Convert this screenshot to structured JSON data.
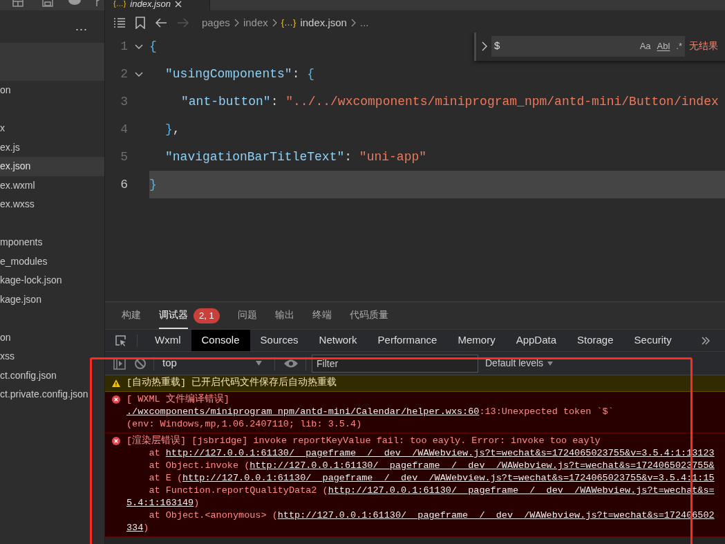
{
  "editor_tab": {
    "icon": "{…}",
    "label": "index.json"
  },
  "sidebar": {
    "more": "...",
    "items": [
      {
        "label": "on",
        "selected": false
      },
      {
        "label": "x",
        "selected": false
      },
      {
        "label": "ex.js",
        "selected": false
      },
      {
        "label": "ex.json",
        "selected": true
      },
      {
        "label": "ex.wxml",
        "selected": false
      },
      {
        "label": "ex.wxss",
        "selected": false
      },
      {
        "label": "mponents",
        "selected": false
      },
      {
        "label": "e_modules",
        "selected": false
      },
      {
        "label": "kage-lock.json",
        "selected": false
      },
      {
        "label": "kage.json",
        "selected": false
      },
      {
        "label": "on",
        "selected": false
      },
      {
        "label": "xss",
        "selected": false
      },
      {
        "label": "ct.config.json",
        "selected": false
      },
      {
        "label": "ct.private.config.json",
        "selected": false
      }
    ]
  },
  "breadcrumb": [
    {
      "label": "pages"
    },
    {
      "label": "index"
    },
    {
      "label": "index.json",
      "icon": "{…}"
    },
    {
      "label": "..."
    }
  ],
  "code_lines": [
    {
      "number": "1",
      "fold": true,
      "active": false,
      "tokens": [
        {
          "kind": "brace",
          "s": "{"
        }
      ],
      "children": [
        {
          "number": "2",
          "fold": true,
          "active": false,
          "tokens": [
            {
              "kind": "key",
              "s": "\"usingComponents\""
            },
            {
              "kind": "plain",
              "s": ": "
            },
            {
              "kind": "brace",
              "s": "{"
            }
          ],
          "children": [
            {
              "number": "3",
              "fold": false,
              "active": false,
              "tokens": [
                {
                  "kind": "key",
                  "s": "\"ant-button\""
                },
                {
                  "kind": "plain",
                  "s": ": "
                },
                {
                  "kind": "string",
                  "s": "\"../../wxcomponents/miniprogram_npm/antd-mini/Button/index"
                }
              ]
            }
          ]
        },
        {
          "number": "4",
          "fold": false,
          "active": false,
          "tokens": [
            {
              "kind": "brace",
              "s": "}"
            },
            {
              "kind": "plain",
              "s": ","
            }
          ]
        },
        {
          "number": "5",
          "fold": false,
          "active": false,
          "tokens": [
            {
              "kind": "key",
              "s": "\"navigationBarTitleText\""
            },
            {
              "kind": "plain",
              "s": ": "
            },
            {
              "kind": "string",
              "s": "\"uni-app\""
            }
          ]
        }
      ]
    },
    {
      "number": "6",
      "fold": false,
      "active": true,
      "tokens": [
        {
          "kind": "brace",
          "s": "}"
        }
      ]
    }
  ],
  "find_widget": {
    "value": "$",
    "toggles": [
      "Aa",
      "Abl",
      ".*"
    ],
    "result": "无结果"
  },
  "panel_tabs": [
    {
      "label": "构建",
      "selected": false
    },
    {
      "label": "调试器",
      "selected": true,
      "badge": "2, 1"
    },
    {
      "label": "问题",
      "selected": false
    },
    {
      "label": "输出",
      "selected": false
    },
    {
      "label": "终端",
      "selected": false
    },
    {
      "label": "代码质量",
      "selected": false
    }
  ],
  "devtools_tabs": [
    {
      "label": "Wxml",
      "selected": false
    },
    {
      "label": "Console",
      "selected": true
    },
    {
      "label": "Sources",
      "selected": false
    },
    {
      "label": "Network",
      "selected": false
    },
    {
      "label": "Performance",
      "selected": false
    },
    {
      "label": "Memory",
      "selected": false
    },
    {
      "label": "AppData",
      "selected": false
    },
    {
      "label": "Storage",
      "selected": false
    },
    {
      "label": "Security",
      "selected": false
    }
  ],
  "console_toolbar": {
    "context": "top",
    "filter_placeholder": "Filter",
    "levels": "Default levels"
  },
  "messages": [
    {
      "kind": "warning",
      "lines": [
        [
          {
            "s": "[自动热重载] 已开启代码文件保存后自动热重载"
          }
        ]
      ]
    },
    {
      "kind": "error",
      "lines": [
        [
          {
            "s": "[ WXML 文件编译错误]"
          }
        ],
        [
          {
            "s": "./wxcomponents/miniprogram_npm/antd-mini/Calendar/helper.wxs:60",
            "link": true
          },
          {
            "s": ":13:Unexpected token `$`"
          }
        ],
        [
          {
            "s": "(env: Windows,mp,1.06.2407110; lib: 3.5.4)"
          }
        ]
      ]
    },
    {
      "kind": "error",
      "lines": [
        [
          {
            "s": "[渲染层错误] [jsbridge] invoke reportKeyValue fail: too eayly. Error: invoke too eayly"
          }
        ],
        [
          {
            "s": "    at "
          },
          {
            "s": "http://127.0.0.1:61130/__pageframe__/__dev__/WAWebview.js?t=wechat&s=1724065023755&v=3.5.4:1:13123",
            "link": true
          }
        ],
        [
          {
            "s": "    at Object.invoke ("
          },
          {
            "s": "http://127.0.0.1:61130/__pageframe__/__dev__/WAWebview.js?t=wechat&s=1724065023755&",
            "link": true
          }
        ],
        [
          {
            "s": "    at E ("
          },
          {
            "s": "http://127.0.0.1:61130/__pageframe__/__dev__/WAWebview.js?t=wechat&s=1724065023755&v=3.5.4:1:15",
            "link": true
          }
        ],
        [
          {
            "s": "    at Function.reportQualityData2 ("
          },
          {
            "s": "http://127.0.0.1:61130/__pageframe__/__dev__/WAWebview.js?t=wechat&s=",
            "link": true
          }
        ],
        [
          {
            "s": "5.4:1:163149",
            "link": true
          },
          {
            "s": ")"
          }
        ],
        [
          {
            "s": "    at Object.<anonymous> ("
          },
          {
            "s": "http://127.0.0.1:61130/__pageframe__/__dev__/WAWebview.js?t=wechat&s=172406502",
            "link": true
          }
        ],
        [
          {
            "s": "334",
            "link": true
          },
          {
            "s": ")"
          }
        ]
      ]
    }
  ],
  "annotation": {
    "kind": "frame"
  }
}
